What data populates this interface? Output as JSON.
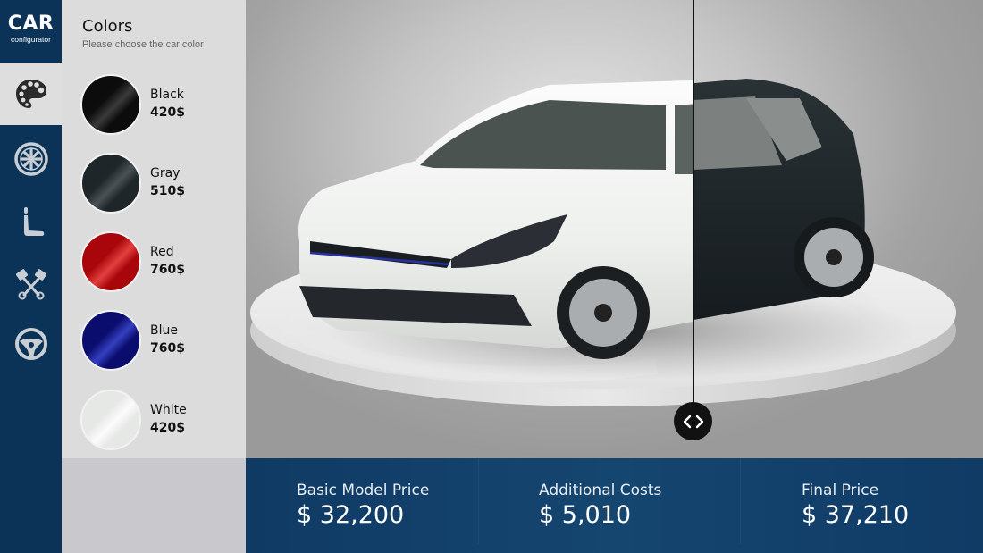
{
  "app": {
    "logo_title": "CAR",
    "logo_subtitle": "configurator"
  },
  "nav": {
    "items": [
      {
        "id": "colors",
        "icon": "palette-icon",
        "active": true
      },
      {
        "id": "wheels",
        "icon": "wheel-rim-icon",
        "active": false
      },
      {
        "id": "seats",
        "icon": "car-seat-icon",
        "active": false
      },
      {
        "id": "engine",
        "icon": "engine-pistons-icon",
        "active": false
      },
      {
        "id": "steering",
        "icon": "steering-wheel-icon",
        "active": false
      }
    ]
  },
  "colors_panel": {
    "title": "Colors",
    "subtitle": "Please choose the car color",
    "options": [
      {
        "name": "Black",
        "price": "420$",
        "color": "#0c0c0c",
        "highlight": "#3a3a3a"
      },
      {
        "name": "Gray",
        "price": "510$",
        "color": "#1f2629",
        "highlight": "#4a5256"
      },
      {
        "name": "Red",
        "price": "760$",
        "color": "#a8060a",
        "highlight": "#e2403f"
      },
      {
        "name": "Blue",
        "price": "760$",
        "color": "#0a0c6e",
        "highlight": "#3540c0"
      },
      {
        "name": "White",
        "price": "420$",
        "color": "#e6e8e6",
        "highlight": "#fbfbfb"
      }
    ]
  },
  "preview": {
    "left_color": "White",
    "right_color": "Gray",
    "compare_handle_icon": "chevron-left-right-icon"
  },
  "pricing": {
    "basic": {
      "label": "Basic Model Price",
      "value": "$ 32,200"
    },
    "additional": {
      "label": "Additional Costs",
      "value": "$ 5,010"
    },
    "final": {
      "label": "Final Price",
      "value": "$ 37,210"
    }
  },
  "theme": {
    "primary": "#0b3358",
    "panel": "#dcdcdc",
    "price_bar": "#154670"
  }
}
